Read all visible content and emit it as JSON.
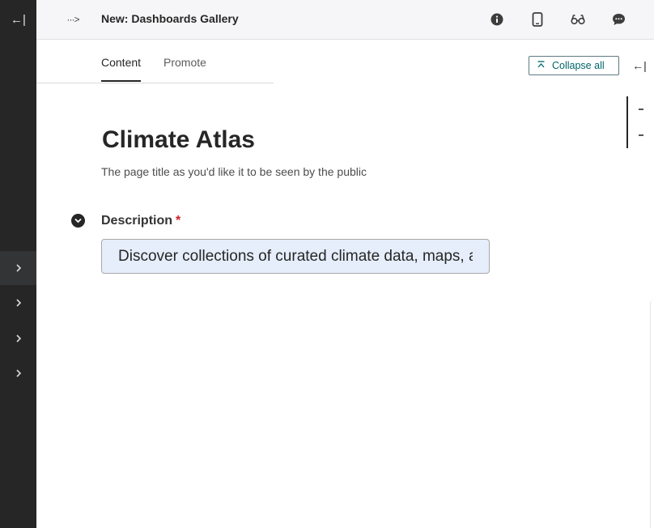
{
  "sidebar": {
    "collapse_icon": "arrow-left-bar-icon",
    "collapse_glyph": "←|",
    "items": [
      {
        "icon": "chevron-right-icon",
        "active": true
      },
      {
        "icon": "chevron-right-icon",
        "active": false
      },
      {
        "icon": "chevron-right-icon",
        "active": false
      },
      {
        "icon": "chevron-right-icon",
        "active": false
      }
    ]
  },
  "header": {
    "breadcrumb_glyph": "···>",
    "title": "New: Dashboards Gallery",
    "icons": [
      "info-icon",
      "mobile-preview-icon",
      "preview-glasses-icon",
      "comment-icon"
    ]
  },
  "tabs": [
    {
      "label": "Content",
      "active": true
    },
    {
      "label": "Promote",
      "active": false
    }
  ],
  "collapse_all": {
    "label": "Collapse all",
    "icon": "collapse-up-icon"
  },
  "side_panel_toggle": {
    "glyph": "←|"
  },
  "form": {
    "title": "Climate Atlas",
    "title_help": "The page title as you'd like it to be seen by the public",
    "description": {
      "label": "Description",
      "required_marker": "*",
      "value": "Discover collections of curated climate data, maps, and dashboards"
    }
  },
  "colors": {
    "sidebar_bg": "#262626",
    "header_bg": "#f6f6f8",
    "accent_teal": "#00676a",
    "required_red": "#cd2026",
    "input_bg": "#e6eefb"
  }
}
